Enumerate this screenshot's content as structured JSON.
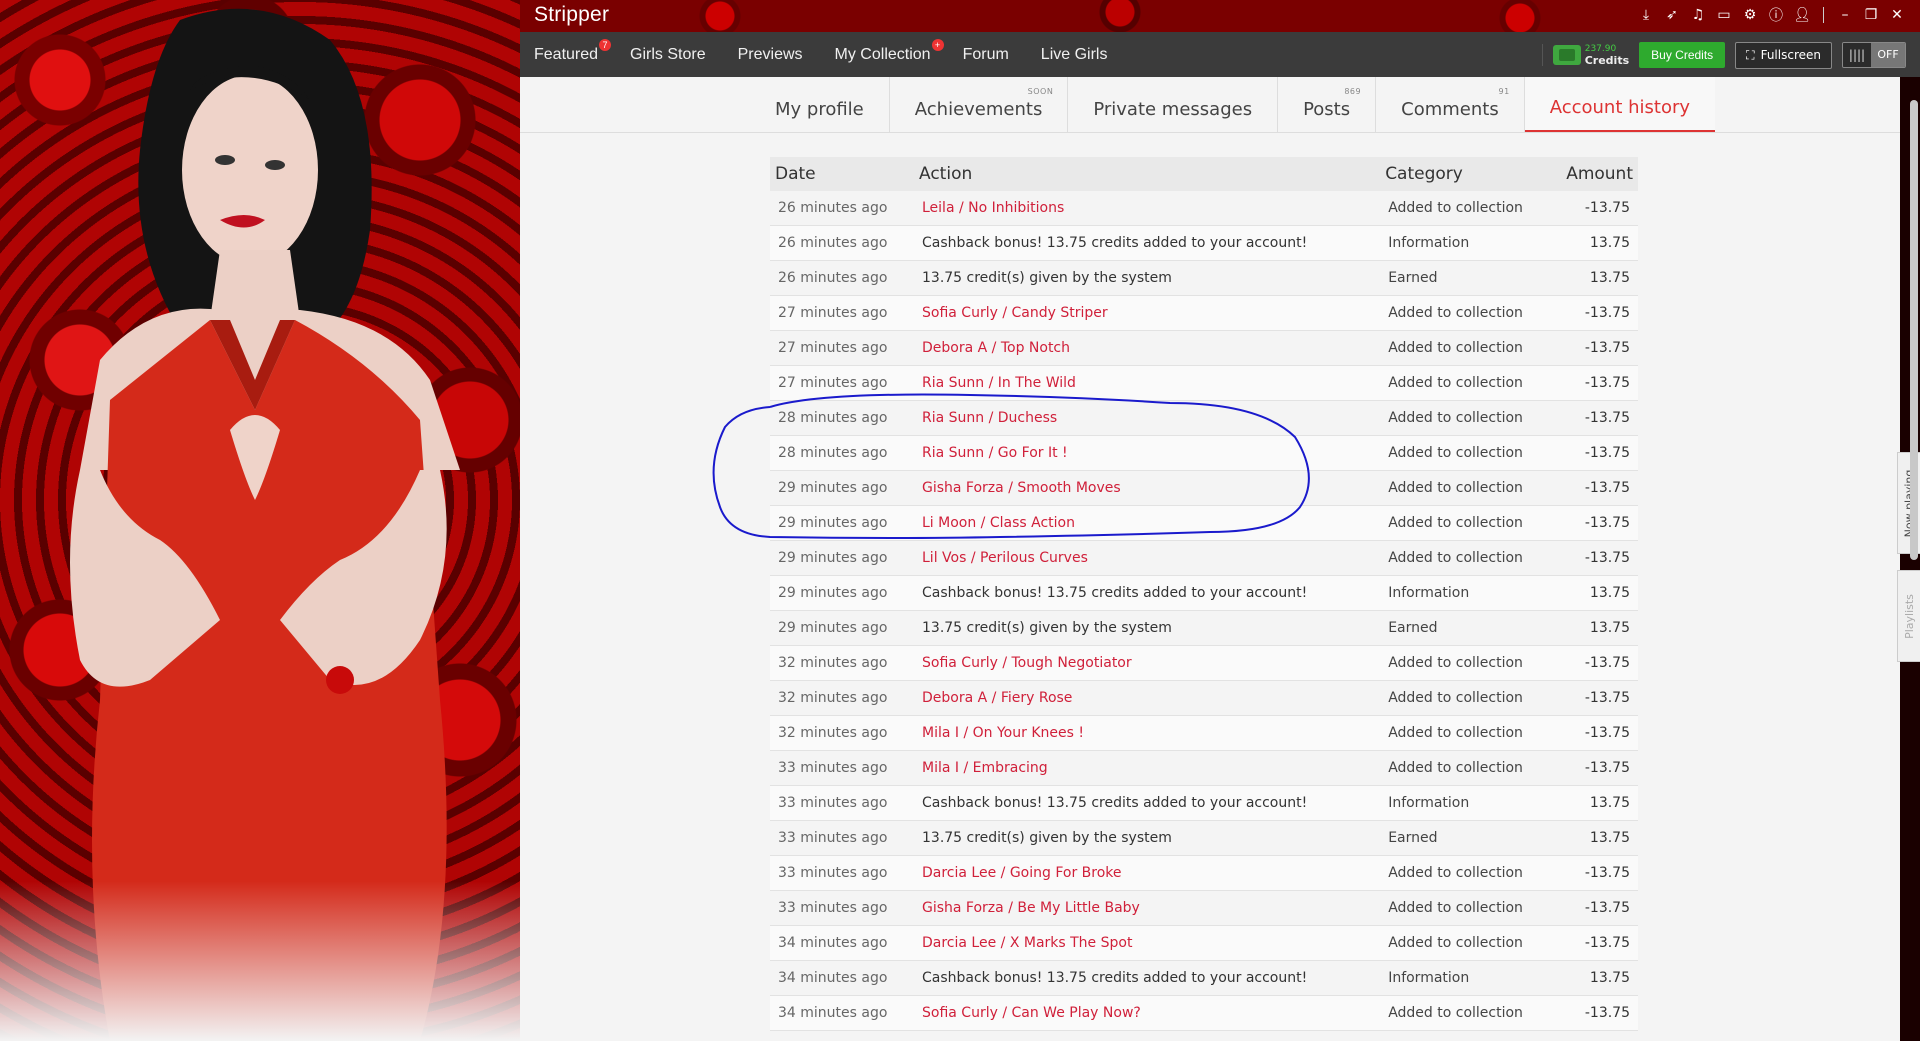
{
  "window": {
    "title": "Stripper",
    "sys_icons": [
      "download-icon",
      "send-icon",
      "music-icon",
      "monitor-icon",
      "settings-icon",
      "info-icon",
      "user-icon",
      "minimize-icon",
      "restore-icon",
      "close-icon"
    ]
  },
  "nav": {
    "items": [
      {
        "label": "Featured",
        "badge": "7"
      },
      {
        "label": "Girls Store",
        "badge": ""
      },
      {
        "label": "Previews",
        "badge": ""
      },
      {
        "label": "My Collection",
        "badge": "+"
      },
      {
        "label": "Forum",
        "badge": ""
      },
      {
        "label": "Live Girls",
        "badge": ""
      }
    ],
    "credits_amount": "237.90",
    "credits_label": "Credits",
    "buy_label": "Buy Credits",
    "fullscreen_label": "Fullscreen",
    "toggle_label": "OFF"
  },
  "tabs": [
    {
      "label": "My profile",
      "badge": "",
      "active": false
    },
    {
      "label": "Achievements",
      "badge": "SOON",
      "active": false
    },
    {
      "label": "Private messages",
      "badge": "",
      "active": false
    },
    {
      "label": "Posts",
      "badge": "869",
      "active": false
    },
    {
      "label": "Comments",
      "badge": "91",
      "active": false
    },
    {
      "label": "Account history",
      "badge": "",
      "active": true
    }
  ],
  "table": {
    "headers": {
      "date": "Date",
      "action": "Action",
      "category": "Category",
      "amount": "Amount"
    },
    "rows": [
      {
        "date": "26 minutes ago",
        "action": "Leila / No Inhibitions",
        "link": true,
        "category": "Added to collection",
        "amount": "-13.75"
      },
      {
        "date": "26 minutes ago",
        "action": "Cashback bonus! 13.75 credits added to your account!",
        "link": false,
        "category": "Information",
        "amount": "13.75"
      },
      {
        "date": "26 minutes ago",
        "action": "13.75 credit(s) given by the system",
        "link": false,
        "category": "Earned",
        "amount": "13.75"
      },
      {
        "date": "27 minutes ago",
        "action": "Sofia Curly / Candy Striper",
        "link": true,
        "category": "Added to collection",
        "amount": "-13.75"
      },
      {
        "date": "27 minutes ago",
        "action": "Debora A / Top Notch",
        "link": true,
        "category": "Added to collection",
        "amount": "-13.75"
      },
      {
        "date": "27 minutes ago",
        "action": "Ria Sunn / In The Wild",
        "link": true,
        "category": "Added to collection",
        "amount": "-13.75"
      },
      {
        "date": "28 minutes ago",
        "action": "Ria Sunn / Duchess",
        "link": true,
        "category": "Added to collection",
        "amount": "-13.75"
      },
      {
        "date": "28 minutes ago",
        "action": "Ria Sunn / Go For It !",
        "link": true,
        "category": "Added to collection",
        "amount": "-13.75"
      },
      {
        "date": "29 minutes ago",
        "action": "Gisha Forza / Smooth Moves",
        "link": true,
        "category": "Added to collection",
        "amount": "-13.75"
      },
      {
        "date": "29 minutes ago",
        "action": "Li Moon / Class Action",
        "link": true,
        "category": "Added to collection",
        "amount": "-13.75"
      },
      {
        "date": "29 minutes ago",
        "action": "Lil Vos / Perilous Curves",
        "link": true,
        "category": "Added to collection",
        "amount": "-13.75"
      },
      {
        "date": "29 minutes ago",
        "action": "Cashback bonus! 13.75 credits added to your account!",
        "link": false,
        "category": "Information",
        "amount": "13.75"
      },
      {
        "date": "29 minutes ago",
        "action": "13.75 credit(s) given by the system",
        "link": false,
        "category": "Earned",
        "amount": "13.75"
      },
      {
        "date": "32 minutes ago",
        "action": "Sofia Curly / Tough Negotiator",
        "link": true,
        "category": "Added to collection",
        "amount": "-13.75"
      },
      {
        "date": "32 minutes ago",
        "action": "Debora A / Fiery Rose",
        "link": true,
        "category": "Added to collection",
        "amount": "-13.75"
      },
      {
        "date": "32 minutes ago",
        "action": "Mila I / On Your Knees !",
        "link": true,
        "category": "Added to collection",
        "amount": "-13.75"
      },
      {
        "date": "33 minutes ago",
        "action": "Mila I / Embracing",
        "link": true,
        "category": "Added to collection",
        "amount": "-13.75"
      },
      {
        "date": "33 minutes ago",
        "action": "Cashback bonus! 13.75 credits added to your account!",
        "link": false,
        "category": "Information",
        "amount": "13.75"
      },
      {
        "date": "33 minutes ago",
        "action": "13.75 credit(s) given by the system",
        "link": false,
        "category": "Earned",
        "amount": "13.75"
      },
      {
        "date": "33 minutes ago",
        "action": "Darcia Lee / Going For Broke",
        "link": true,
        "category": "Added to collection",
        "amount": "-13.75"
      },
      {
        "date": "33 minutes ago",
        "action": "Gisha Forza / Be My Little Baby",
        "link": true,
        "category": "Added to collection",
        "amount": "-13.75"
      },
      {
        "date": "34 minutes ago",
        "action": "Darcia Lee / X Marks The Spot",
        "link": true,
        "category": "Added to collection",
        "amount": "-13.75"
      },
      {
        "date": "34 minutes ago",
        "action": "Cashback bonus! 13.75 credits added to your account!",
        "link": false,
        "category": "Information",
        "amount": "13.75"
      },
      {
        "date": "34 minutes ago",
        "action": "Sofia Curly / Can We Play Now?",
        "link": true,
        "category": "Added to collection",
        "amount": "-13.75"
      }
    ]
  },
  "side_tabs": {
    "now_playing": "Now playing",
    "playlists": "Playlists"
  },
  "colors": {
    "accent": "#d0203a",
    "positive": "#2a9a2a",
    "annotation": "#1a1acc"
  }
}
